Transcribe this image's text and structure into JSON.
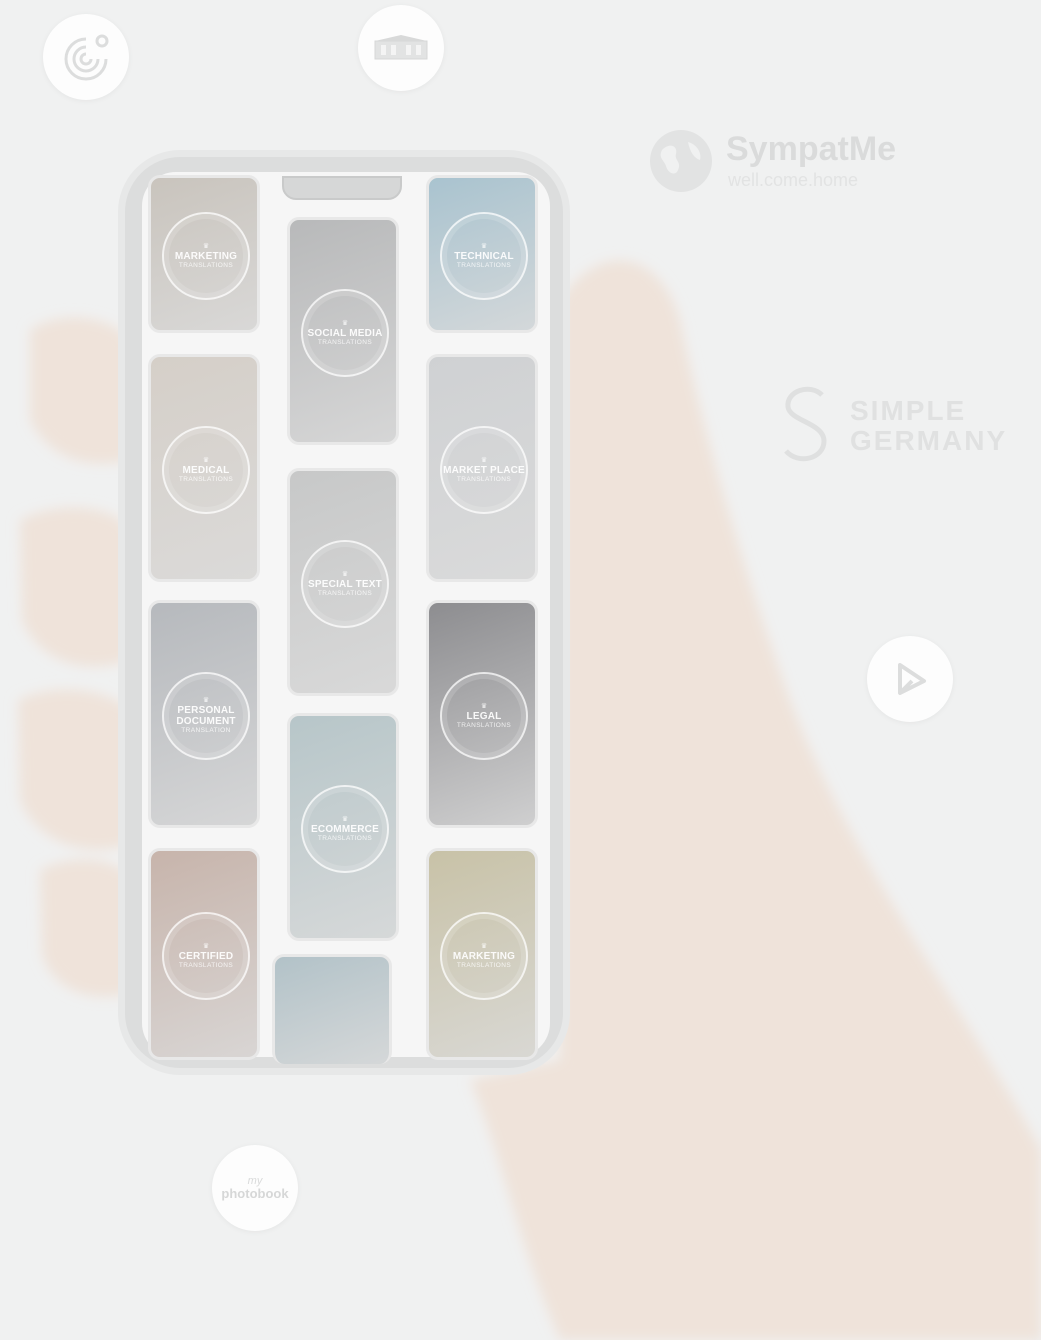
{
  "brands": {
    "sympatme_name": "SympatMe",
    "sympatme_tagline": "well.come.home",
    "simple_germany_line1": "SIMPLE",
    "simple_germany_line2": "GERMANY",
    "myphotobook_line1": "my",
    "myphotobook_line2": "photobook"
  },
  "cards": [
    {
      "title": "MARKETING",
      "subtitle": "TRANSLATIONS",
      "color": "#c9c4bd"
    },
    {
      "title": "SOCIAL MEDIA",
      "subtitle": "TRANSLATIONS",
      "color": "#b8b9ba"
    },
    {
      "title": "TECHNICAL",
      "subtitle": "TRANSLATIONS",
      "color": "#a9c3cf"
    },
    {
      "title": "MEDICAL",
      "subtitle": "TRANSLATIONS",
      "color": "#d5cfc8"
    },
    {
      "title": "MARKET PLACE",
      "subtitle": "TRANSLATIONS",
      "color": "#cfd1d3"
    },
    {
      "title": "SPECIAL TEXT",
      "subtitle": "TRANSLATIONS",
      "color": "#c7c8c8"
    },
    {
      "title": "PERSONAL\nDOCUMENT",
      "subtitle": "TRANSLATION",
      "color": "#b6b9bd"
    },
    {
      "title": "LEGAL",
      "subtitle": "TRANSLATIONS",
      "color": "#8d8d90"
    },
    {
      "title": "ECOMMERCE",
      "subtitle": "TRANSLATIONS",
      "color": "#b7c6c9"
    },
    {
      "title": "CERTIFIED",
      "subtitle": "TRANSLATIONS",
      "color": "#c7b4ab"
    },
    {
      "title": "MARKETING",
      "subtitle": "TRANSLATIONS",
      "color": "#c8c2a7"
    },
    {
      "title": "",
      "subtitle": "",
      "color": "#b2c2c8"
    }
  ]
}
